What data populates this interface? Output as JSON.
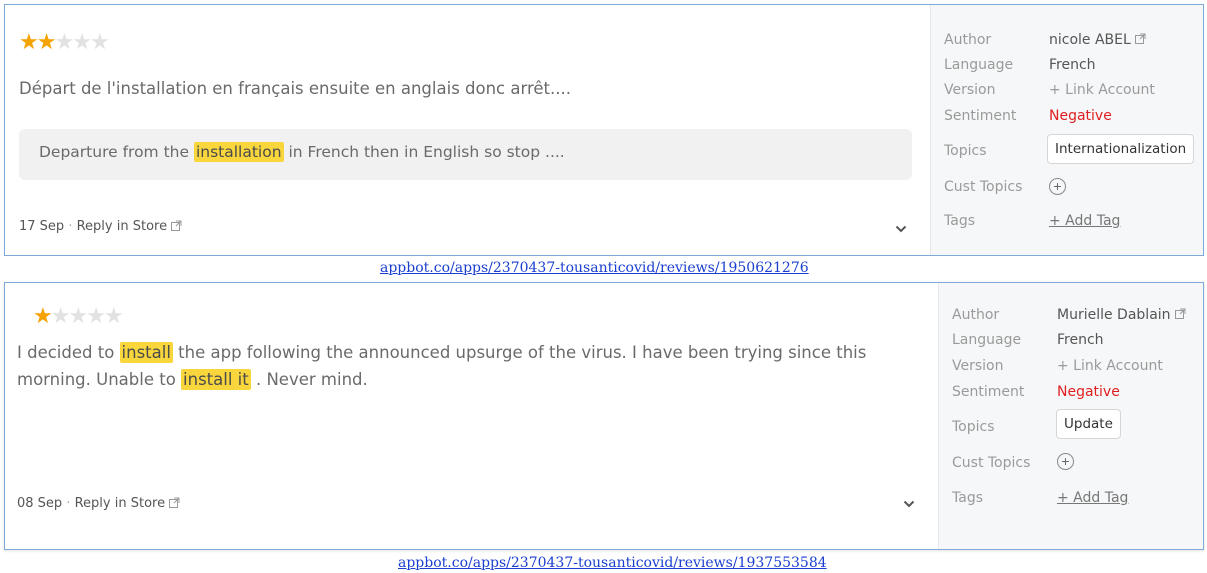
{
  "reviews": [
    {
      "rating": 2,
      "max_rating": 5,
      "text_before": "Départ de l'installation en français ensuite en anglais donc arrêt....",
      "translation": {
        "before": "Departure from the ",
        "highlight": "installation",
        "after": " in French then in English so stop ...."
      },
      "date": "17 Sep",
      "separator": "·",
      "reply_label": "Reply in Store",
      "sidebar": {
        "author_label": "Author",
        "author": "nicole ABEL",
        "language_label": "Language",
        "language": "French",
        "version_label": "Version",
        "version": "+ Link Account",
        "sentiment_label": "Sentiment",
        "sentiment": "Negative",
        "topics_label": "Topics",
        "topic": "Internationalization",
        "cust_topics_label": "Cust Topics",
        "add_icon": "⊕",
        "tags_label": "Tags",
        "add_tag": "+ Add Tag"
      },
      "url": "appbot.co/apps/2370437-tousanticovid/reviews/1950621276"
    },
    {
      "rating": 1,
      "max_rating": 5,
      "text": {
        "part1": "I decided to ",
        "hl1": "install",
        "part2": " the app following the announced upsurge of the virus. I have been trying since this morning. Unable to ",
        "hl2": "install it",
        "part3": " . Never mind."
      },
      "date": "08 Sep",
      "separator": "·",
      "reply_label": "Reply in Store",
      "sidebar": {
        "author_label": "Author",
        "author": "Murielle Dablain",
        "language_label": "Language",
        "language": "French",
        "version_label": "Version",
        "version": "+ Link Account",
        "sentiment_label": "Sentiment",
        "sentiment": "Negative",
        "topics_label": "Topics",
        "topic": "Update",
        "cust_topics_label": "Cust Topics",
        "tags_label": "Tags",
        "add_tag": "+ Add Tag"
      },
      "url": "appbot.co/apps/2370437-tousanticovid/reviews/1937553584"
    }
  ],
  "icons": {
    "star": "★",
    "external_link": "external-link-icon",
    "chevron": "chevron-down-icon",
    "add": "plus-circle-icon"
  },
  "colors": {
    "star_on": "#f5a300",
    "star_off": "#e2e2e2",
    "highlight": "#f9d63c",
    "negative": "#e02020",
    "card_border": "#7fa9d9",
    "url": "#1a3fd0"
  }
}
